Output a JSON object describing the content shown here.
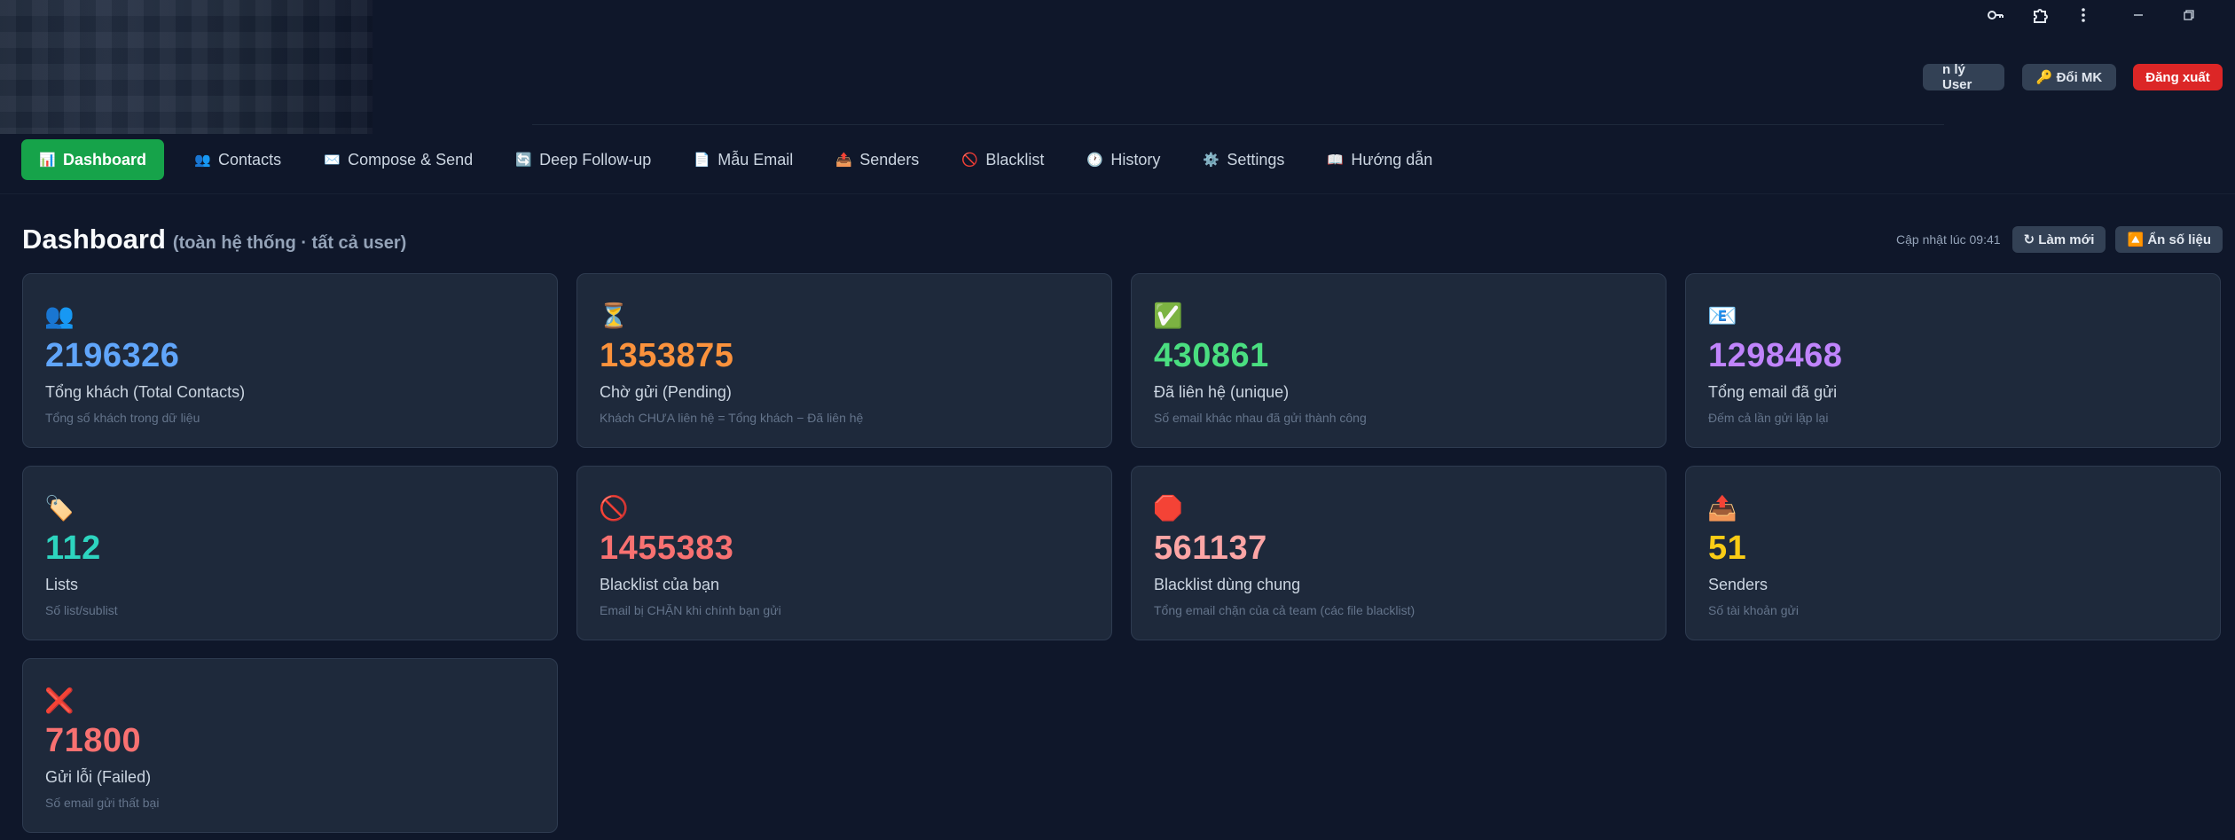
{
  "window": {
    "controls": [
      "key-icon",
      "extension-icon",
      "more-vert-icon",
      "minimize-icon",
      "restore-icon"
    ]
  },
  "header": {
    "user_button": "n lý User",
    "change_password": "🔑 Đổi MK",
    "logout": "Đăng xuất"
  },
  "nav": {
    "tabs": [
      {
        "icon": "📊",
        "label": "Dashboard",
        "active": true
      },
      {
        "icon": "👥",
        "label": "Contacts"
      },
      {
        "icon": "✉️",
        "label": "Compose & Send"
      },
      {
        "icon": "🔄",
        "label": "Deep Follow-up"
      },
      {
        "icon": "📄",
        "label": "Mẫu Email"
      },
      {
        "icon": "📤",
        "label": "Senders"
      },
      {
        "icon": "🚫",
        "label": "Blacklist"
      },
      {
        "icon": "🕐",
        "label": "History"
      },
      {
        "icon": "⚙️",
        "label": "Settings"
      },
      {
        "icon": "📖",
        "label": "Hướng dẫn"
      }
    ]
  },
  "dashboard": {
    "title": "Dashboard",
    "subtitle": "(toàn hệ thống · tất cả user)",
    "updated": "Cập nhật lúc 09:41",
    "refresh_button": "↻ Làm mới",
    "hide_button": "🔼 Ẩn số liệu"
  },
  "cards": [
    {
      "icon": "👥",
      "value": "2196326",
      "color": "#60a5fa",
      "label": "Tổng khách (Total Contacts)",
      "desc": "Tổng số khách trong dữ liệu"
    },
    {
      "icon": "⏳",
      "value": "1353875",
      "color": "#fb923c",
      "label": "Chờ gửi (Pending)",
      "desc": "Khách CHƯA liên hệ = Tổng khách − Đã liên hệ"
    },
    {
      "icon": "✅",
      "value": "430861",
      "color": "#4ade80",
      "label": "Đã liên hệ (unique)",
      "desc": "Số email khác nhau đã gửi thành công"
    },
    {
      "icon": "📧",
      "value": "1298468",
      "color": "#c084fc",
      "label": "Tổng email đã gửi",
      "desc": "Đếm cả lần gửi lặp lại"
    },
    {
      "icon": "🏷️",
      "value": "112",
      "color": "#2dd4bf",
      "label": "Lists",
      "desc": "Số list/sublist"
    },
    {
      "icon": "🚫",
      "value": "1455383",
      "color": "#f87171",
      "label": "Blacklist của bạn",
      "desc": "Email bị CHẶN khi chính bạn gửi"
    },
    {
      "icon": "🛑",
      "value": "561137",
      "color": "#fca5a5",
      "label": "Blacklist dùng chung",
      "desc": "Tổng email chặn của cả team (các file blacklist)"
    },
    {
      "icon": "📤",
      "value": "51",
      "color": "#facc15",
      "label": "Senders",
      "desc": "Số tài khoản gửi"
    },
    {
      "icon": "❌",
      "value": "71800",
      "color": "#f87171",
      "label": "Gửi lỗi (Failed)",
      "desc": "Số email gửi thất bại"
    }
  ]
}
